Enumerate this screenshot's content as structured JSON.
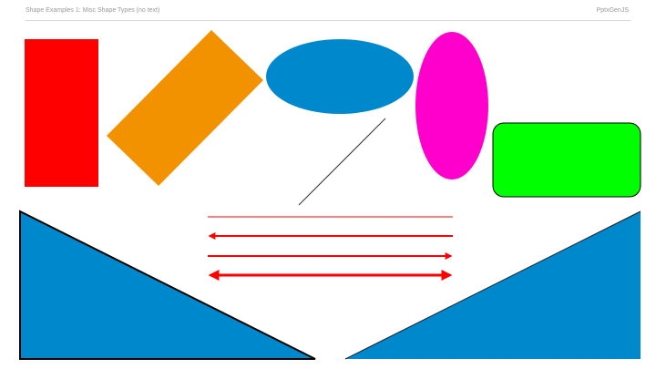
{
  "slide": {
    "title": "Shape Examples 1: Misc Shape Types (no text)",
    "brand": "PptxGenJS"
  },
  "colors": {
    "rectangle": "#FF0000",
    "rotated_rectangle": "#F39200",
    "ellipse": "#0088CC",
    "vertical_ellipse": "#FF00CC",
    "rounded_rectangle": "#00FF00",
    "triangles": "#0088CC",
    "arrows": "#FF0000",
    "outline": "#000000",
    "diagonal_line": "#333333"
  },
  "shapes": [
    "rectangle",
    "rotated-rectangle",
    "ellipse",
    "vertical-ellipse",
    "rounded-rectangle",
    "diagonal-line",
    "plain-line",
    "left-arrow-line",
    "right-arrow-line",
    "double-arrow-line",
    "right-triangle-left",
    "right-triangle-right"
  ]
}
